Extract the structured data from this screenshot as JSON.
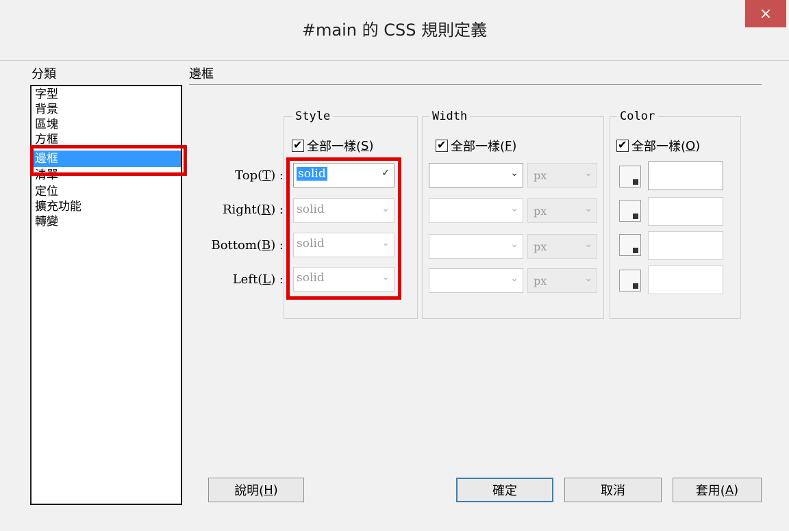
{
  "window": {
    "title": "#main 的 CSS 規則定義",
    "close_glyph": "×"
  },
  "sidebar": {
    "label": "分類",
    "items": [
      "字型",
      "背景",
      "區塊",
      "方框",
      "邊框",
      "清單",
      "定位",
      "擴充功能",
      "轉變"
    ],
    "selected_index": 4
  },
  "section": {
    "title": "邊框"
  },
  "groups": {
    "style": {
      "title": "Style",
      "same_label": "全部一樣(",
      "same_key": "S",
      "same_close": ")"
    },
    "width": {
      "title": "Width",
      "same_label": "全部一樣(",
      "same_key": "F",
      "same_close": ")"
    },
    "color": {
      "title": "Color",
      "same_label": "全部一樣(",
      "same_key": "O",
      "same_close": ")"
    }
  },
  "rows": [
    {
      "label": "Top(",
      "key": "T",
      "label_end": ") :",
      "style_value": "solid",
      "width_value": "",
      "unit": "px",
      "color_value": ""
    },
    {
      "label": "Right(",
      "key": "R",
      "label_end": ") :",
      "style_value": "solid",
      "width_value": "",
      "unit": "px",
      "color_value": ""
    },
    {
      "label": "Bottom(",
      "key": "B",
      "label_end": ") :",
      "style_value": "solid",
      "width_value": "",
      "unit": "px",
      "color_value": ""
    },
    {
      "label": "Left(",
      "key": "L",
      "label_end": ") :",
      "style_value": "solid",
      "width_value": "",
      "unit": "px",
      "color_value": ""
    }
  ],
  "buttons": {
    "help": {
      "label": "說明(",
      "key": "H",
      "close": ")"
    },
    "ok": {
      "label": "確定"
    },
    "cancel": {
      "label": "取消"
    },
    "apply": {
      "label": "套用(",
      "key": "A",
      "close": ")"
    }
  },
  "colors": {
    "highlight": "#e30000",
    "selection": "#3399ff",
    "close_button": "#c75050"
  }
}
